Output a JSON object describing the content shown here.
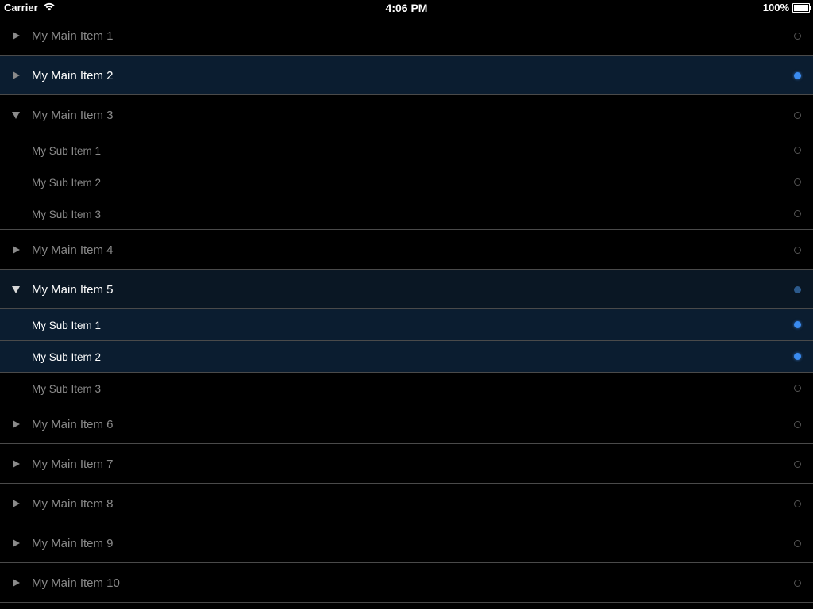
{
  "status_bar": {
    "carrier": "Carrier",
    "time": "4:06 PM",
    "battery": "100%",
    "battery_level_percent": 100
  },
  "colors": {
    "background": "#000000",
    "selected_row": "#0b1d30",
    "accent_dot": "#3a8bf0",
    "partial_dot": "#2c5a8c",
    "text_normal": "#8a8a8a",
    "text_selected": "#ffffff"
  },
  "tree": {
    "items": [
      {
        "label": "My Main Item 1",
        "expanded": false,
        "selection": "none"
      },
      {
        "label": "My Main Item 2",
        "expanded": false,
        "selection": "full"
      },
      {
        "label": "My Main Item 3",
        "expanded": true,
        "selection": "none",
        "children": [
          {
            "label": "My Sub Item 1",
            "selected": false
          },
          {
            "label": "My Sub Item 2",
            "selected": false
          },
          {
            "label": "My Sub Item 3",
            "selected": false
          }
        ]
      },
      {
        "label": "My Main Item 4",
        "expanded": false,
        "selection": "none"
      },
      {
        "label": "My Main Item 5",
        "expanded": true,
        "selection": "partial",
        "children": [
          {
            "label": "My Sub Item 1",
            "selected": true
          },
          {
            "label": "My Sub Item 2",
            "selected": true
          },
          {
            "label": "My Sub Item 3",
            "selected": false
          }
        ]
      },
      {
        "label": "My Main Item 6",
        "expanded": false,
        "selection": "none"
      },
      {
        "label": "My Main Item 7",
        "expanded": false,
        "selection": "none"
      },
      {
        "label": "My Main Item 8",
        "expanded": false,
        "selection": "none"
      },
      {
        "label": "My Main Item 9",
        "expanded": false,
        "selection": "none"
      },
      {
        "label": "My Main Item 10",
        "expanded": false,
        "selection": "none"
      }
    ]
  },
  "icons": {
    "collapsed": "disclosure-right-icon",
    "expanded": "disclosure-down-icon",
    "selection": "selection-dot-icon"
  }
}
